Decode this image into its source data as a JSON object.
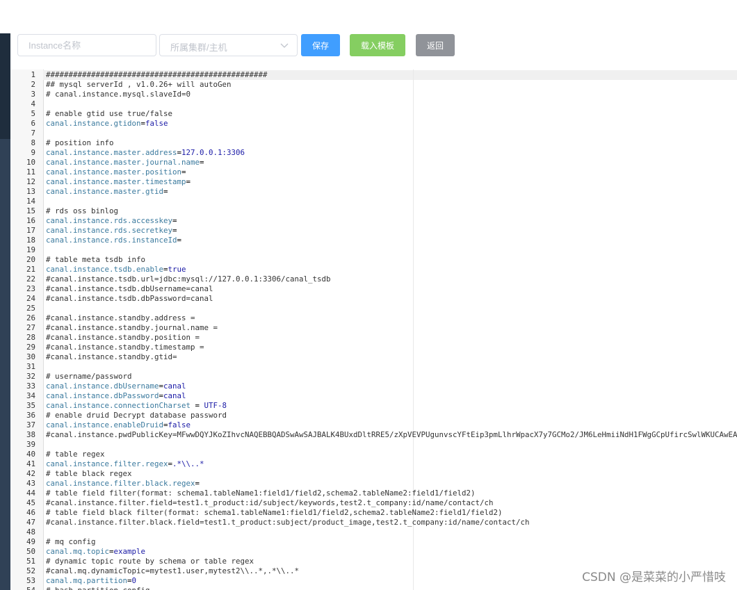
{
  "toolbar": {
    "instance_placeholder": "Instance名称",
    "cluster_placeholder": "所属集群/主机",
    "save_label": "保存",
    "load_template_label": "载入模板",
    "back_label": "返回"
  },
  "editor": {
    "lines": [
      {
        "n": "1",
        "k": "",
        "op": "",
        "v": "",
        "c": "#################################################"
      },
      {
        "n": "2",
        "k": "",
        "op": "",
        "v": "",
        "c": "## mysql serverId , v1.0.26+ will autoGen"
      },
      {
        "n": "3",
        "k": "",
        "op": "",
        "v": "",
        "c": "# canal.instance.mysql.slaveId=0"
      },
      {
        "n": "4",
        "k": "",
        "op": "",
        "v": "",
        "c": ""
      },
      {
        "n": "5",
        "k": "",
        "op": "",
        "v": "",
        "c": "# enable gtid use true/false"
      },
      {
        "n": "6",
        "k": "canal.instance.gtidon",
        "op": "=",
        "v": "false",
        "c": ""
      },
      {
        "n": "7",
        "k": "",
        "op": "",
        "v": "",
        "c": ""
      },
      {
        "n": "8",
        "k": "",
        "op": "",
        "v": "",
        "c": "# position info"
      },
      {
        "n": "9",
        "k": "canal.instance.master.address",
        "op": "=",
        "v": "127.0.0.1:3306",
        "c": ""
      },
      {
        "n": "10",
        "k": "canal.instance.master.journal.name",
        "op": "=",
        "v": "",
        "c": ""
      },
      {
        "n": "11",
        "k": "canal.instance.master.position",
        "op": "=",
        "v": "",
        "c": ""
      },
      {
        "n": "12",
        "k": "canal.instance.master.timestamp",
        "op": "=",
        "v": "",
        "c": ""
      },
      {
        "n": "13",
        "k": "canal.instance.master.gtid",
        "op": "=",
        "v": "",
        "c": ""
      },
      {
        "n": "14",
        "k": "",
        "op": "",
        "v": "",
        "c": ""
      },
      {
        "n": "15",
        "k": "",
        "op": "",
        "v": "",
        "c": "# rds oss binlog"
      },
      {
        "n": "16",
        "k": "canal.instance.rds.accesskey",
        "op": "=",
        "v": "",
        "c": ""
      },
      {
        "n": "17",
        "k": "canal.instance.rds.secretkey",
        "op": "=",
        "v": "",
        "c": ""
      },
      {
        "n": "18",
        "k": "canal.instance.rds.instanceId",
        "op": "=",
        "v": "",
        "c": ""
      },
      {
        "n": "19",
        "k": "",
        "op": "",
        "v": "",
        "c": ""
      },
      {
        "n": "20",
        "k": "",
        "op": "",
        "v": "",
        "c": "# table meta tsdb info"
      },
      {
        "n": "21",
        "k": "canal.instance.tsdb.enable",
        "op": "=",
        "v": "true",
        "c": ""
      },
      {
        "n": "22",
        "k": "",
        "op": "",
        "v": "",
        "c": "#canal.instance.tsdb.url=jdbc:mysql://127.0.0.1:3306/canal_tsdb"
      },
      {
        "n": "23",
        "k": "",
        "op": "",
        "v": "",
        "c": "#canal.instance.tsdb.dbUsername=canal"
      },
      {
        "n": "24",
        "k": "",
        "op": "",
        "v": "",
        "c": "#canal.instance.tsdb.dbPassword=canal"
      },
      {
        "n": "25",
        "k": "",
        "op": "",
        "v": "",
        "c": ""
      },
      {
        "n": "26",
        "k": "",
        "op": "",
        "v": "",
        "c": "#canal.instance.standby.address ="
      },
      {
        "n": "27",
        "k": "",
        "op": "",
        "v": "",
        "c": "#canal.instance.standby.journal.name ="
      },
      {
        "n": "28",
        "k": "",
        "op": "",
        "v": "",
        "c": "#canal.instance.standby.position ="
      },
      {
        "n": "29",
        "k": "",
        "op": "",
        "v": "",
        "c": "#canal.instance.standby.timestamp ="
      },
      {
        "n": "30",
        "k": "",
        "op": "",
        "v": "",
        "c": "#canal.instance.standby.gtid="
      },
      {
        "n": "31",
        "k": "",
        "op": "",
        "v": "",
        "c": ""
      },
      {
        "n": "32",
        "k": "",
        "op": "",
        "v": "",
        "c": "# username/password"
      },
      {
        "n": "33",
        "k": "canal.instance.dbUsername",
        "op": "=",
        "v": "canal",
        "c": ""
      },
      {
        "n": "34",
        "k": "canal.instance.dbPassword",
        "op": "=",
        "v": "canal",
        "c": ""
      },
      {
        "n": "35",
        "k": "canal.instance.connectionCharset",
        "op": " = ",
        "v": "UTF-8",
        "c": ""
      },
      {
        "n": "36",
        "k": "",
        "op": "",
        "v": "",
        "c": "# enable druid Decrypt database password"
      },
      {
        "n": "37",
        "k": "canal.instance.enableDruid",
        "op": "=",
        "v": "false",
        "c": ""
      },
      {
        "n": "38",
        "k": "",
        "op": "",
        "v": "",
        "c": "#canal.instance.pwdPublicKey=MFwwDQYJKoZIhvcNAQEBBQADSwAwSAJBALK4BUxdDltRRE5/zXpVEVPUgunvscYFtEip3pmLlhrWpacX7y7GCMo2/JM6LeHmiiNdH1FWgGCpUfircSwlWKUCAwEAAQ=="
      },
      {
        "n": "39",
        "k": "",
        "op": "",
        "v": "",
        "c": ""
      },
      {
        "n": "40",
        "k": "",
        "op": "",
        "v": "",
        "c": "# table regex"
      },
      {
        "n": "41",
        "k": "canal.instance.filter.regex",
        "op": "=",
        "v": ".*\\\\..*",
        "c": ""
      },
      {
        "n": "42",
        "k": "",
        "op": "",
        "v": "",
        "c": "# table black regex"
      },
      {
        "n": "43",
        "k": "canal.instance.filter.black.regex",
        "op": "=",
        "v": "",
        "c": ""
      },
      {
        "n": "44",
        "k": "",
        "op": "",
        "v": "",
        "c": "# table field filter(format: schema1.tableName1:field1/field2,schema2.tableName2:field1/field2)"
      },
      {
        "n": "45",
        "k": "",
        "op": "",
        "v": "",
        "c": "#canal.instance.filter.field=test1.t_product:id/subject/keywords,test2.t_company:id/name/contact/ch"
      },
      {
        "n": "46",
        "k": "",
        "op": "",
        "v": "",
        "c": "# table field black filter(format: schema1.tableName1:field1/field2,schema2.tableName2:field1/field2)"
      },
      {
        "n": "47",
        "k": "",
        "op": "",
        "v": "",
        "c": "#canal.instance.filter.black.field=test1.t_product:subject/product_image,test2.t_company:id/name/contact/ch"
      },
      {
        "n": "48",
        "k": "",
        "op": "",
        "v": "",
        "c": ""
      },
      {
        "n": "49",
        "k": "",
        "op": "",
        "v": "",
        "c": "# mq config"
      },
      {
        "n": "50",
        "k": "canal.mq.topic",
        "op": "=",
        "v": "example",
        "c": ""
      },
      {
        "n": "51",
        "k": "",
        "op": "",
        "v": "",
        "c": "# dynamic topic route by schema or table regex"
      },
      {
        "n": "52",
        "k": "",
        "op": "",
        "v": "",
        "c": "#canal.mq.dynamicTopic=mytest1.user,mytest2\\\\..*,.*\\\\..*"
      },
      {
        "n": "53",
        "k": "canal.mq.partition",
        "op": "=",
        "v": "0",
        "c": ""
      },
      {
        "n": "54",
        "k": "",
        "op": "",
        "v": "",
        "c": "# hash partition config"
      }
    ]
  },
  "watermark": "CSDN @是菜菜的小严惜吱"
}
